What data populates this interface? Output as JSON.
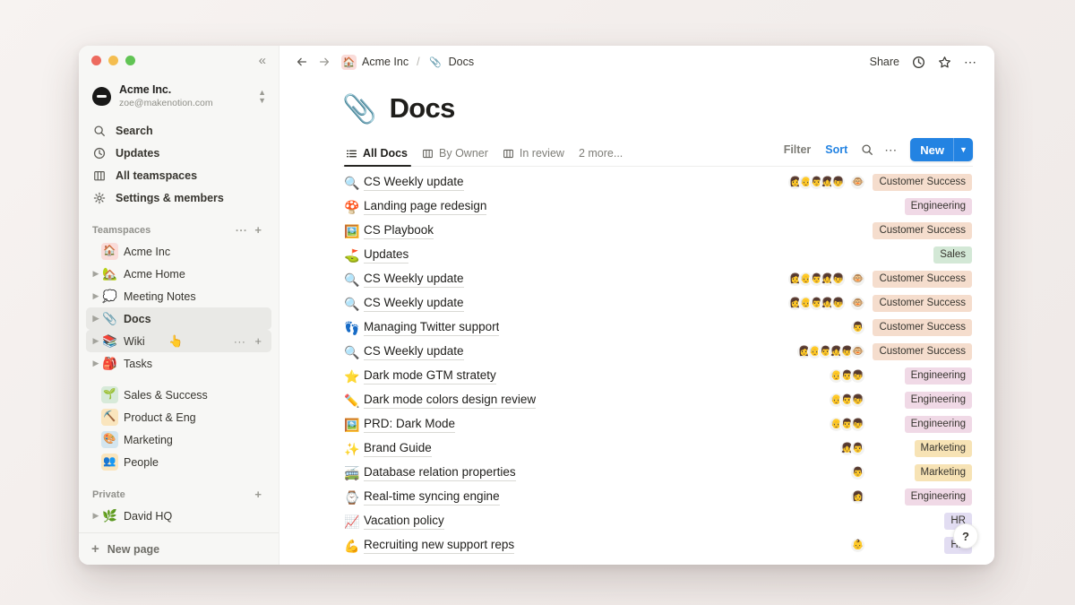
{
  "window": {
    "traffic_lights": [
      "close",
      "minimize",
      "maximize"
    ],
    "collapse_label": "«"
  },
  "sidebar": {
    "workspace": {
      "name": "Acme Inc.",
      "email": "zoe@makenotion.com",
      "switcher_icon": "chevron-up-down-icon"
    },
    "nav": [
      {
        "label": "Search",
        "icon": "search-icon"
      },
      {
        "label": "Updates",
        "icon": "clock-icon"
      },
      {
        "label": "All teamspaces",
        "icon": "building-icon"
      },
      {
        "label": "Settings & members",
        "icon": "gear-icon"
      }
    ],
    "teamspaces_section": {
      "label": "Teamspaces",
      "more_label": "···",
      "add_label": "+"
    },
    "teamspaces": [
      {
        "label": "Acme Inc",
        "emoji": "🏠",
        "badge_color": "#fadcd9",
        "twisty": false,
        "state": "normal"
      },
      {
        "label": "Acme Home",
        "emoji": "🏡",
        "twisty": true,
        "state": "normal"
      },
      {
        "label": "Meeting Notes",
        "emoji": "💭",
        "twisty": true,
        "state": "normal"
      },
      {
        "label": "Docs",
        "emoji": "📎",
        "twisty": true,
        "state": "active"
      },
      {
        "label": "Wiki",
        "emoji": "📚",
        "twisty": true,
        "state": "hovered"
      },
      {
        "label": "Tasks",
        "emoji": "🎒",
        "twisty": true,
        "state": "normal"
      }
    ],
    "teams": [
      {
        "label": "Sales & Success",
        "emoji": "🌱",
        "badge_color": "#d7ead9"
      },
      {
        "label": "Product & Eng",
        "emoji": "⛏️",
        "badge_color": "#fae5bd"
      },
      {
        "label": "Marketing",
        "emoji": "🎨",
        "badge_color": "#d3e5ef"
      },
      {
        "label": "People",
        "emoji": "👥",
        "badge_color": "#fae5bd"
      }
    ],
    "private_section": {
      "label": "Private",
      "add_label": "+"
    },
    "private_items": [
      {
        "label": "David HQ",
        "emoji": "🌿",
        "twisty": true
      }
    ],
    "new_page": {
      "label": "New page",
      "icon": "plus-icon"
    }
  },
  "topbar": {
    "back_icon": "arrow-left-icon",
    "forward_icon": "arrow-right-icon",
    "breadcrumb": [
      {
        "label": "Acme Inc",
        "emoji": "🏠",
        "badge_color": "#fadcd9"
      },
      {
        "label": "Docs",
        "emoji": "📎",
        "badge_color": "transparent"
      }
    ],
    "separator": "/",
    "share_label": "Share",
    "history_icon": "clock-icon",
    "favorite_icon": "star-icon",
    "more_icon": "ellipsis-icon"
  },
  "page": {
    "emoji": "📎",
    "title": "Docs"
  },
  "views": {
    "tabs": [
      {
        "label": "All Docs",
        "icon": "list-icon",
        "active": true
      },
      {
        "label": "By Owner",
        "icon": "board-icon",
        "active": false
      },
      {
        "label": "In review",
        "icon": "board-icon",
        "active": false
      }
    ],
    "more_label": "2 more...",
    "filter_label": "Filter",
    "sort_label": "Sort",
    "search_icon": "search-icon",
    "more_icon": "ellipsis-icon",
    "new_label": "New",
    "new_chevron": "chevron-down-icon"
  },
  "tag_colors": {
    "Customer Success": "#f5ddcd",
    "Engineering": "#f0d9e6",
    "Sales": "#d3e8d6",
    "Marketing": "#f7e3b5",
    "HR": "#e2ddf2"
  },
  "docs": [
    {
      "title": "CS Weekly update",
      "emoji": "🔍",
      "tag": "Customer Success",
      "avatars": [
        "👩",
        "👴",
        "👨",
        "👧",
        "👦"
      ],
      "extra_avatar": "🐵"
    },
    {
      "title": "Landing page redesign",
      "emoji": "🍄",
      "tag": "Engineering",
      "avatars": [],
      "extra_avatar": null
    },
    {
      "title": "CS Playbook",
      "emoji": "🖼️",
      "tag": "Customer Success",
      "avatars": [],
      "extra_avatar": null
    },
    {
      "title": "Updates",
      "emoji": "⛳",
      "tag": "Sales",
      "avatars": [],
      "extra_avatar": null
    },
    {
      "title": "CS Weekly update",
      "emoji": "🔍",
      "tag": "Customer Success",
      "avatars": [
        "👩",
        "👴",
        "👨",
        "👧",
        "👦"
      ],
      "extra_avatar": "🐵"
    },
    {
      "title": "CS Weekly update",
      "emoji": "🔍",
      "tag": "Customer Success",
      "avatars": [
        "👩",
        "👴",
        "👨",
        "👧",
        "👦"
      ],
      "extra_avatar": "🐵"
    },
    {
      "title": "Managing Twitter support",
      "emoji": "👣",
      "tag": "Customer Success",
      "avatars": [
        "👨"
      ],
      "extra_avatar": null
    },
    {
      "title": "CS Weekly update",
      "emoji": "🔍",
      "tag": "Customer Success",
      "avatars": [
        "👩",
        "👴",
        "👨",
        "👧",
        "👦",
        "🐵"
      ],
      "extra_avatar": null
    },
    {
      "title": "Dark mode GTM stratety",
      "emoji": "⭐",
      "tag": "Engineering",
      "avatars": [
        "👴",
        "👨",
        "👦"
      ],
      "extra_avatar": null
    },
    {
      "title": "Dark mode colors design review",
      "emoji": "✏️",
      "tag": "Engineering",
      "avatars": [
        "👴",
        "👨",
        "👦"
      ],
      "extra_avatar": null
    },
    {
      "title": "PRD: Dark Mode",
      "emoji": "🖼️",
      "tag": "Engineering",
      "avatars": [
        "👴",
        "👨",
        "👦"
      ],
      "extra_avatar": null
    },
    {
      "title": "Brand Guide",
      "emoji": "✨",
      "tag": "Marketing",
      "avatars": [
        "👧",
        "👨"
      ],
      "extra_avatar": null
    },
    {
      "title": "Database relation properties",
      "emoji": "🚎",
      "tag": "Marketing",
      "avatars": [
        "👨"
      ],
      "extra_avatar": null
    },
    {
      "title": "Real-time syncing engine",
      "emoji": "⌚",
      "tag": "Engineering",
      "avatars": [
        "👩"
      ],
      "extra_avatar": null
    },
    {
      "title": "Vacation policy",
      "emoji": "📈",
      "tag": "HR",
      "avatars": [],
      "extra_avatar": null
    },
    {
      "title": "Recruiting new support reps",
      "emoji": "💪",
      "tag": "HR",
      "avatars": [
        "👶"
      ],
      "extra_avatar": null
    }
  ],
  "help": {
    "label": "?"
  }
}
